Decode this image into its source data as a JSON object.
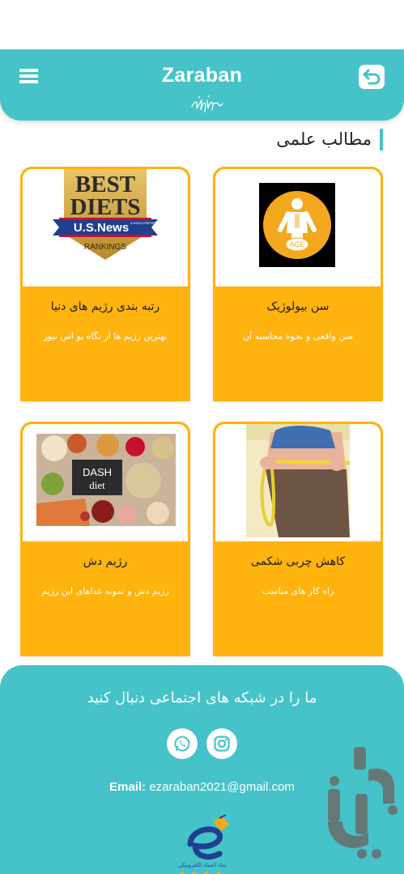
{
  "header": {
    "title": "Zaraban",
    "menu_icon": "hamburger-menu-icon",
    "back_icon": "back-arrow-icon",
    "color": "#45c3c8"
  },
  "section": {
    "title": "مطالب علمی"
  },
  "cards": [
    {
      "title": "سن بیولوژیک",
      "description": "سن واقعی و نحوه محاسبه آن",
      "image": "age-body-icon",
      "image_text": "AGE"
    },
    {
      "title": "رتبه بندی رژیم های دنیا",
      "description": "بهترین رژیم ها از نگاه یو اس نیوز",
      "image": "best-diets-usnews-logo",
      "image_text": {
        "line1": "BEST",
        "line2": "DIETS",
        "line3": "U.S.News",
        "line4": "RANKINGS",
        "small": "& WORLD REPORT"
      }
    },
    {
      "title": "کاهش چربی شکمی",
      "description": "راه کار های مناسب",
      "image": "waist-measuring-photo"
    },
    {
      "title": "رژیم دش",
      "description": "رژیم دش و نمونه غداهای این رژیم",
      "image": "dash-diet-food-photo",
      "image_text": {
        "line1": "DASH",
        "line2": "diet"
      }
    }
  ],
  "card_color": "#ffb30f",
  "footer": {
    "follow_text": "ما را در شبکه های اجتماعی دنبال کنید",
    "email_label": "Email:",
    "email": "ezaraban2021@gmail.com",
    "badge": "enamad-trust-badge",
    "badge_text": "نماد اعتماد الکترونیکی"
  }
}
